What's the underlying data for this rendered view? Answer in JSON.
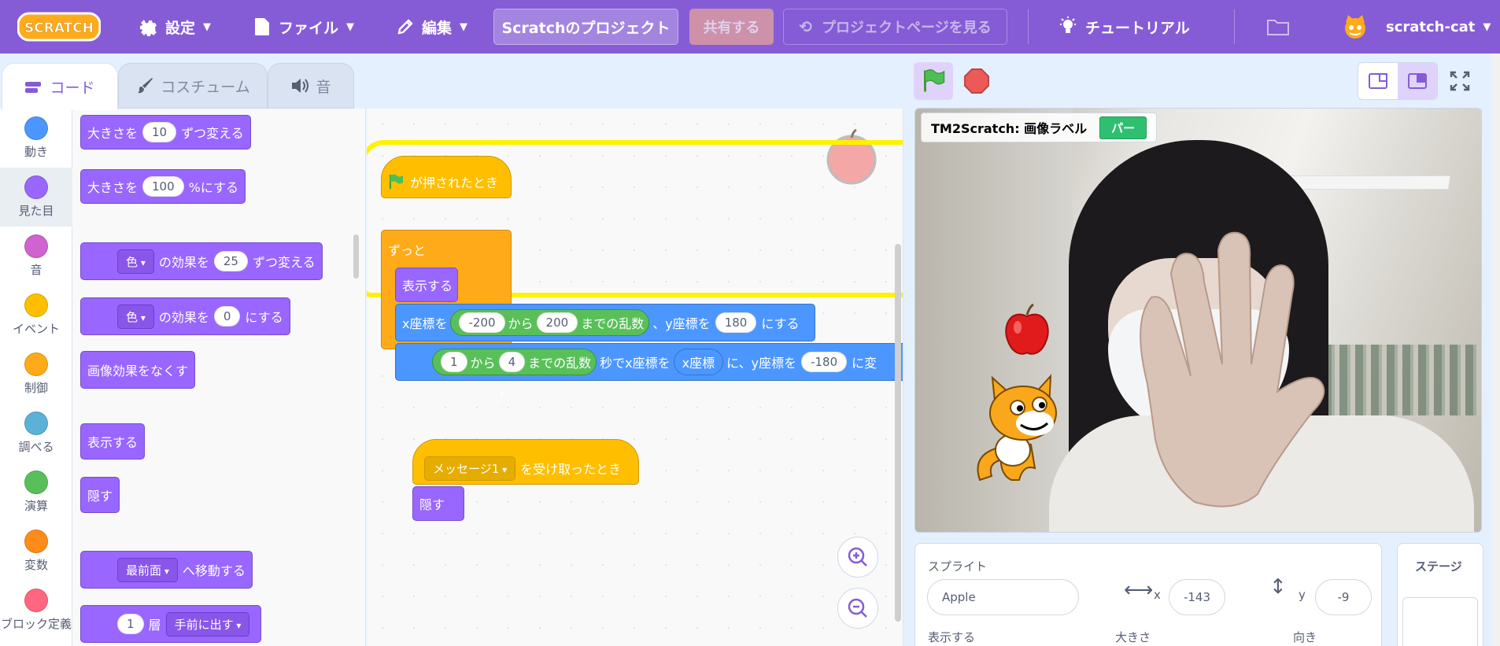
{
  "menubar": {
    "logo_text": "SCRATCH",
    "settings": "設定",
    "file": "ファイル",
    "edit": "編集",
    "project_title": "Scratchのプロジェクト",
    "share": "共有する",
    "see_project_page": "プロジェクトページを見る",
    "tutorials": "チュートリアル",
    "username": "scratch-cat"
  },
  "tabs": {
    "code": "コード",
    "costumes": "コスチューム",
    "sounds": "音"
  },
  "categories": [
    {
      "label": "動き",
      "color": "#4c97ff"
    },
    {
      "label": "見た目",
      "color": "#9966ff"
    },
    {
      "label": "音",
      "color": "#cf63cf"
    },
    {
      "label": "イベント",
      "color": "#ffbf00"
    },
    {
      "label": "制御",
      "color": "#ffab19"
    },
    {
      "label": "調べる",
      "color": "#5cb1d6"
    },
    {
      "label": "演算",
      "color": "#59c059"
    },
    {
      "label": "変数",
      "color": "#ff8c1a"
    },
    {
      "label": "ブロック定義",
      "color": "#ff6680"
    }
  ],
  "flyout": {
    "change_size": {
      "pre": "大きさを",
      "val": "10",
      "post": "ずつ変える"
    },
    "set_size": {
      "pre": "大きさを",
      "val": "100",
      "post": "%にする"
    },
    "change_effect": {
      "drop": "色",
      "mid": "の効果を",
      "val": "25",
      "post": "ずつ変える"
    },
    "set_effect": {
      "drop": "色",
      "mid": "の効果を",
      "val": "0",
      "post": "にする"
    },
    "clear_effects": "画像効果をなくす",
    "show": "表示する",
    "hide": "隠す",
    "go_to_layer": {
      "drop": "最前面",
      "post": "へ移動する"
    },
    "go_layers": {
      "val": "1",
      "mid": "層",
      "drop": "手前に出す"
    }
  },
  "script": {
    "when_flag": "が押されたとき",
    "forever": "ずっと",
    "show": "表示する",
    "goto": {
      "x_label": "x座標を",
      "from": "-200",
      "kara": "から",
      "to": "200",
      "random": "までの乱数",
      "y_label": "、y座標を",
      "y": "180",
      "suru": "にする"
    },
    "glide": {
      "from": "1",
      "kara": "から",
      "to": "4",
      "random": "までの乱数",
      "sec": "秒でx座標を",
      "xpos": "x座標",
      "ni": "に、y座標を",
      "y": "-180",
      "tail": "に変"
    },
    "when_receive": {
      "msg": "メッセージ1",
      "post": "を受け取ったとき"
    },
    "hide": "隠す"
  },
  "stage": {
    "label": "TM2Scratch: 画像ラベル",
    "label_value": "パー"
  },
  "sprite_info": {
    "sprite_label": "スプライト",
    "name": "Apple",
    "x_label": "x",
    "x": "-143",
    "y_label": "y",
    "y": "-9",
    "show_label": "表示する",
    "size_label": "大きさ",
    "direction_label": "向き"
  },
  "stage_pane": {
    "label": "ステージ"
  }
}
